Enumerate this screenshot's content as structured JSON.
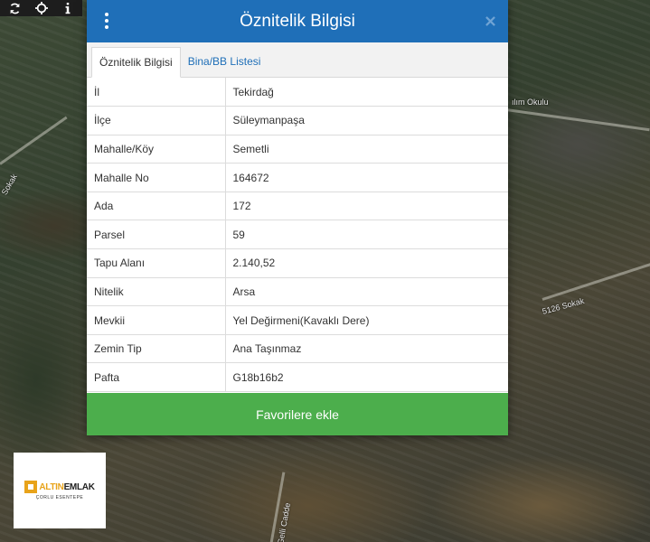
{
  "colors": {
    "header": "#1f6fb8",
    "favorite_button": "#4cae4c",
    "tab_link": "#1f6fb8",
    "logo_accent": "#e8a31a"
  },
  "map": {
    "tools": [
      {
        "icon": "refresh-icon"
      },
      {
        "icon": "locate-icon"
      },
      {
        "icon": "info-icon"
      }
    ],
    "labels": {
      "school": "ılım Okulu",
      "street_right": "5126 Sokak",
      "street_left": "Sokak",
      "street_bottom": "Gelli Cadde"
    },
    "watermark": "Sa"
  },
  "dialog": {
    "title": "Öznitelik Bilgisi",
    "menu_icon": "vertical-dots-icon",
    "close_icon": "close-icon",
    "tabs": [
      {
        "label": "Öznitelik Bilgisi",
        "active": true
      },
      {
        "label": "Bina/BB Listesi",
        "active": false
      }
    ],
    "rows": [
      {
        "key": "İl",
        "value": "Tekirdağ"
      },
      {
        "key": "İlçe",
        "value": "Süleymanpaşa"
      },
      {
        "key": "Mahalle/Köy",
        "value": "Semetli"
      },
      {
        "key": "Mahalle No",
        "value": "164672"
      },
      {
        "key": "Ada",
        "value": "172"
      },
      {
        "key": "Parsel",
        "value": "59"
      },
      {
        "key": "Tapu Alanı",
        "value": "2.140,52"
      },
      {
        "key": "Nitelik",
        "value": "Arsa"
      },
      {
        "key": "Mevkii",
        "value": "Yel Değirmeni(Kavaklı Dere)"
      },
      {
        "key": "Zemin Tip",
        "value": "Ana Taşınmaz"
      },
      {
        "key": "Pafta",
        "value": "G18b16b2"
      }
    ],
    "favorite_button": "Favorilere ekle"
  },
  "logo": {
    "brand_part1": "ALTIN",
    "brand_part2": "EMLAK",
    "subtitle": "ÇORLU ESENTEPE"
  }
}
